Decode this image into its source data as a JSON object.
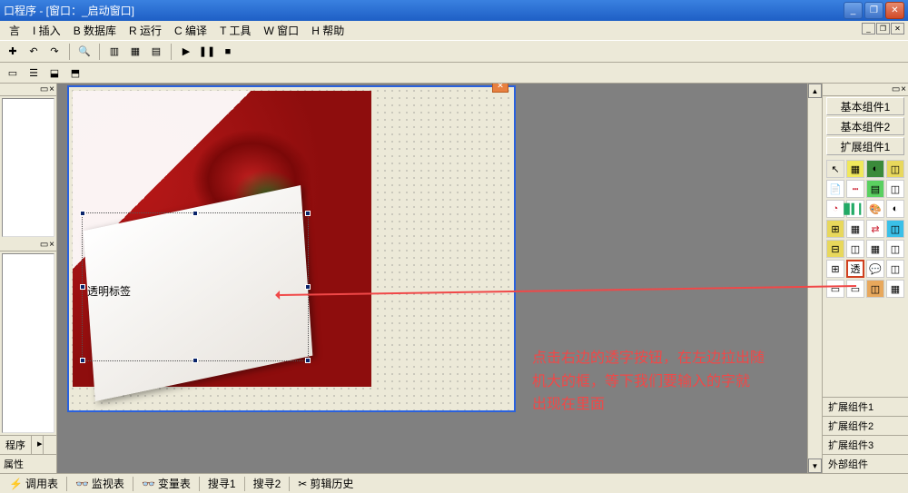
{
  "window": {
    "title": "口程序 - [窗口：_启动窗口]"
  },
  "menu": {
    "items": [
      "言",
      "I 插入",
      "B 数据库",
      "R 运行",
      "C 编译",
      "T 工具",
      "W 窗口",
      "H 帮助"
    ]
  },
  "left_panel": {
    "header_marker": "▭ ×",
    "tab1": "程序",
    "tab2": "",
    "prop_tab": "属性"
  },
  "canvas": {
    "label_text": "透明标签"
  },
  "right_panel": {
    "header_marker": "▭ ×",
    "tabs": [
      "基本组件1",
      "基本组件2",
      "扩展组件1"
    ],
    "bottom_tabs": [
      "扩展组件1",
      "扩展组件2",
      "扩展组件3",
      "外部组件"
    ],
    "highlighted_tool": "透"
  },
  "bottom_tabs": {
    "items": [
      "调用表",
      "监视表",
      "变量表",
      "搜寻1",
      "搜寻2",
      "剪辑历史"
    ]
  },
  "annotation": {
    "line1": "点击右边的透字按钮，在左边拉出随",
    "line2": "机大的框，等下我们要输入的字就",
    "line3": "出现在里面"
  },
  "icons": {
    "arrow": "↖",
    "run": "▶",
    "stop": "■",
    "pause": "❚❚"
  }
}
